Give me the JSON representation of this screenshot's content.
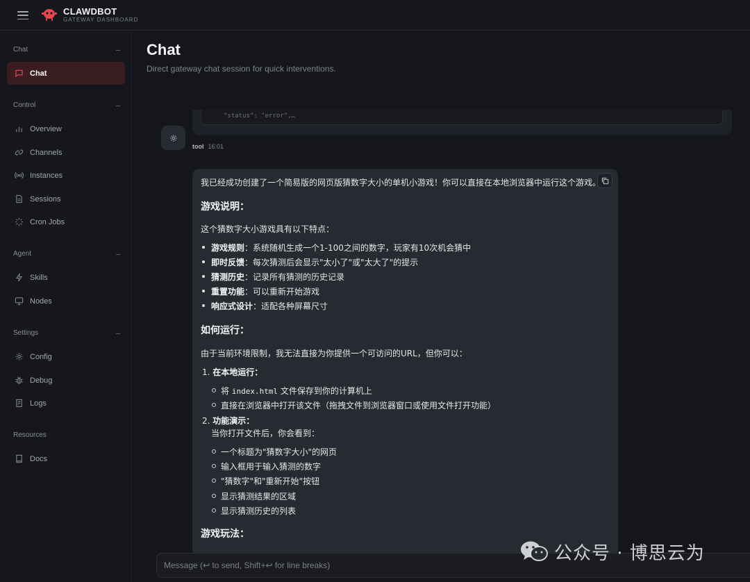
{
  "brand": {
    "title": "CLAWDBOT",
    "subtitle": "GATEWAY DASHBOARD"
  },
  "sidebar": {
    "sections": [
      {
        "label": "Chat",
        "items": [
          {
            "label": "Chat",
            "icon": "message-square-icon",
            "active": true
          }
        ]
      },
      {
        "label": "Control",
        "items": [
          {
            "label": "Overview",
            "icon": "bar-chart-icon"
          },
          {
            "label": "Channels",
            "icon": "link-icon"
          },
          {
            "label": "Instances",
            "icon": "radio-icon"
          },
          {
            "label": "Sessions",
            "icon": "file-text-icon"
          },
          {
            "label": "Cron Jobs",
            "icon": "loader-icon"
          }
        ]
      },
      {
        "label": "Agent",
        "items": [
          {
            "label": "Skills",
            "icon": "zap-icon"
          },
          {
            "label": "Nodes",
            "icon": "monitor-icon"
          }
        ]
      },
      {
        "label": "Settings",
        "items": [
          {
            "label": "Config",
            "icon": "gear-icon"
          },
          {
            "label": "Debug",
            "icon": "bug-icon"
          },
          {
            "label": "Logs",
            "icon": "file-list-icon"
          }
        ]
      },
      {
        "label": "Resources",
        "items": [
          {
            "label": "Docs",
            "icon": "book-icon"
          }
        ]
      }
    ]
  },
  "header": {
    "title": "Chat",
    "subtitle": "Direct gateway chat session for quick interventions."
  },
  "tool_message": {
    "code_snippet": "\"status\": \"error\",…",
    "role": "tool",
    "time": "16:01"
  },
  "assistant_message": {
    "intro": "我已经成功创建了一个简易版的网页版猜数字大小的单机小游戏！你可以直接在本地浏览器中运行这个游戏。",
    "h_desc": "游戏说明：",
    "desc_intro": "这个猜数字大小游戏具有以下特点：",
    "features": [
      {
        "label": "游戏规则",
        "text": "：系统随机生成一个1-100之间的数字，玩家有10次机会猜中"
      },
      {
        "label": "即时反馈",
        "text": "：每次猜测后会显示\"太小了\"或\"太大了\"的提示"
      },
      {
        "label": "猜测历史",
        "text": "：记录所有猜测的历史记录"
      },
      {
        "label": "重置功能",
        "text": "：可以重新开始游戏"
      },
      {
        "label": "响应式设计",
        "text": "：适配各种屏幕尺寸"
      }
    ],
    "h_run": "如何运行：",
    "run_intro": "由于当前环境限制，我无法直接为你提供一个可访问的URL，但你可以：",
    "step1_label": "在本地运行：",
    "step1_a_prefix": "将 ",
    "step1_a_code": "index.html",
    "step1_a_suffix": " 文件保存到你的计算机上",
    "step1_b": "直接在浏览器中打开该文件（拖拽文件到浏览器窗口或使用文件打开功能）",
    "step2_label": "功能演示：",
    "step2_intro": "当你打开文件后，你会看到：",
    "step2_items": [
      "一个标题为\"猜数字大小\"的网页",
      "输入框用于输入猜测的数字",
      "\"猜数字\"和\"重新开始\"按钮",
      "显示猜测结果的区域",
      "显示猜测历史的列表"
    ],
    "h_play": "游戏玩法："
  },
  "composer": {
    "placeholder": "Message (↩ to send, Shift+↩ for line breaks)"
  },
  "watermark": {
    "text": "公众号 · 博思云为"
  },
  "colors": {
    "accent": "#e5484d",
    "active_bg": "#3a1d20",
    "bubble_bg": "#262a31",
    "page_bg": "#14161b"
  }
}
